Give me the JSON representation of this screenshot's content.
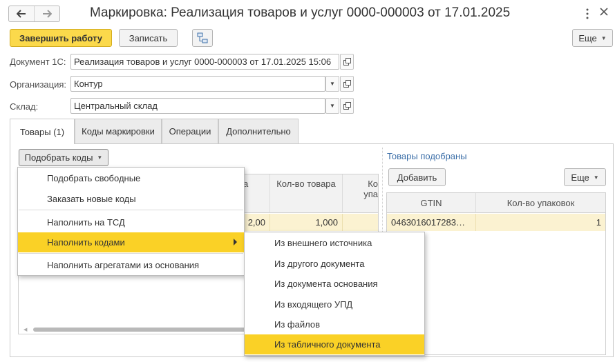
{
  "window": {
    "title": "Маркировка: Реализация товаров и услуг 0000-000003 от 17.01.2025"
  },
  "toolbar": {
    "finish_label": "Завершить работу",
    "save_label": "Записать",
    "more_label": "Еще"
  },
  "fields": {
    "document_label": "Документ 1С:",
    "document_value": "Реализация товаров и услуг 0000-000003 от 17.01.2025 15:06",
    "organization_label": "Организация:",
    "organization_value": "Контур",
    "warehouse_label": "Склад:",
    "warehouse_value": "Центральный склад"
  },
  "tabs": [
    {
      "label": "Товары (1)",
      "active": true
    },
    {
      "label": "Коды маркировки",
      "active": false
    },
    {
      "label": "Операции",
      "active": false
    },
    {
      "label": "Дополнительно",
      "active": false
    }
  ],
  "left_panel": {
    "pick_codes_label": "Подобрать коды",
    "columns": [
      "а",
      "Кол-во товара",
      "Ко упа"
    ],
    "col_partial_1": "Ко",
    "col_partial_2": "упа",
    "row": [
      "2,00",
      "1,000",
      ""
    ]
  },
  "right_panel": {
    "header": "Товары подобраны",
    "add_label": "Добавить",
    "more_label": "Еще",
    "columns": [
      "GTIN",
      "Кол-во упаковок"
    ],
    "row": [
      "0463016017283…",
      "1"
    ]
  },
  "dropdown_menu": {
    "items": [
      {
        "label": "Подобрать свободные",
        "highlighted": false
      },
      {
        "label": "Заказать новые коды",
        "highlighted": false
      },
      {
        "label": "Наполнить на ТСД",
        "highlighted": false
      },
      {
        "label": "Наполнить кодами",
        "highlighted": true,
        "has_submenu": true
      },
      {
        "label": "Наполнить агрегатами из основания",
        "highlighted": false
      }
    ]
  },
  "submenu": {
    "items": [
      {
        "label": "Из внешнего источника",
        "highlighted": false
      },
      {
        "label": "Из другого документа",
        "highlighted": false
      },
      {
        "label": "Из документа основания",
        "highlighted": false
      },
      {
        "label": "Из входящего УПД",
        "highlighted": false
      },
      {
        "label": "Из файлов",
        "highlighted": false
      },
      {
        "label": "Из табличного документа",
        "highlighted": true
      }
    ]
  },
  "colors": {
    "accent_yellow": "#fbd94b",
    "highlight_yellow": "#fad126",
    "selected_row": "#fbf2d1",
    "link_blue": "#3c6fa8"
  },
  "icons": [
    "arrow-left-icon",
    "arrow-right-icon",
    "kebab-menu-icon",
    "close-icon",
    "structure-icon",
    "chevron-down-icon",
    "open-link-icon",
    "submenu-arrow-icon"
  ]
}
